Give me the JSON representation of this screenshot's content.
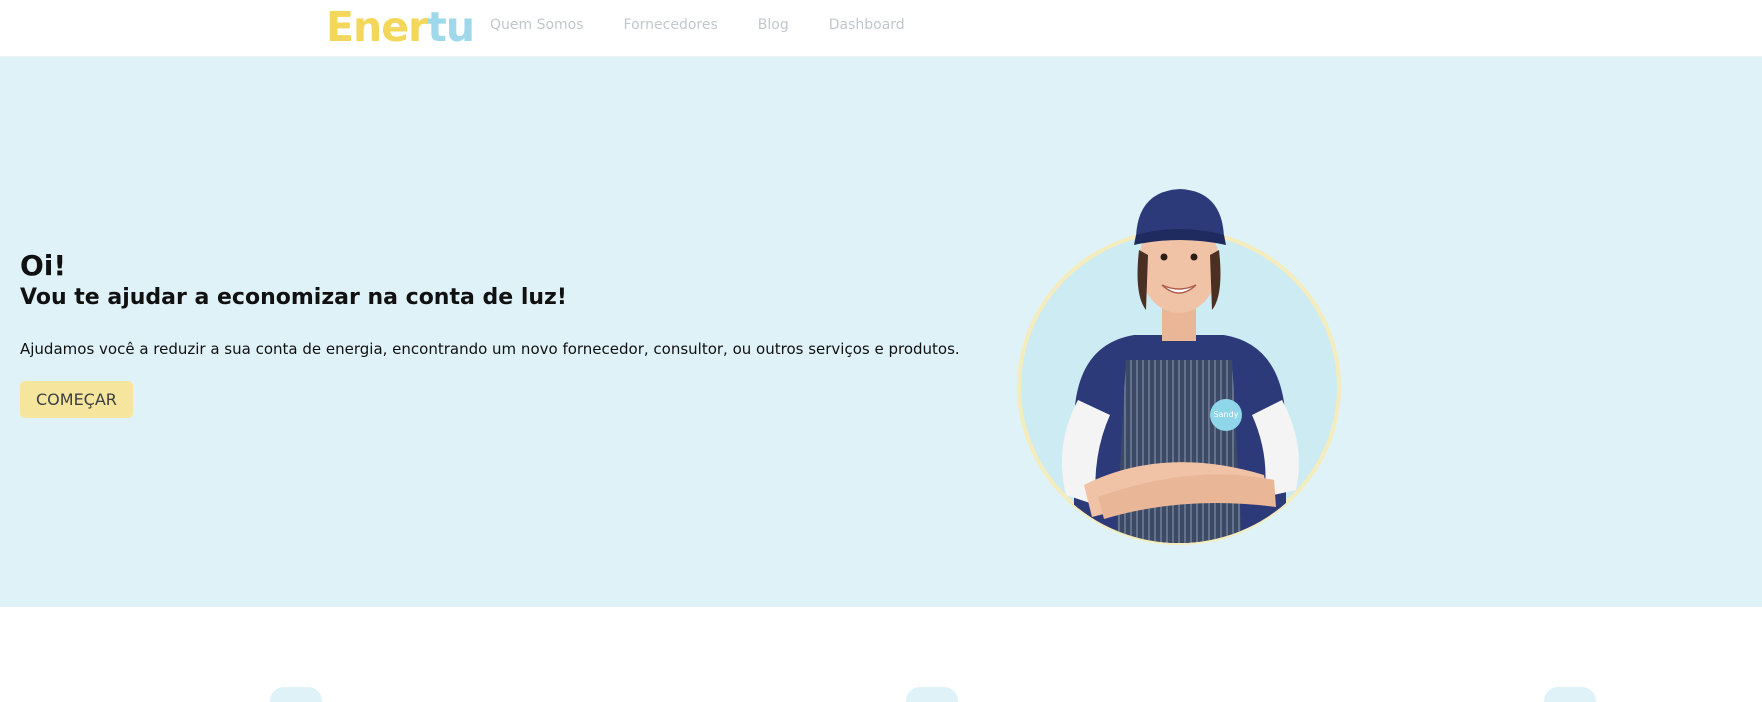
{
  "brand": {
    "logo_part1": "Ener",
    "logo_part2": "tu",
    "color_primary": "#f3d75a",
    "color_secondary": "#9fd8ea"
  },
  "nav": {
    "items": [
      {
        "label": "Quem Somos"
      },
      {
        "label": "Fornecedores"
      },
      {
        "label": "Blog"
      },
      {
        "label": "Dashboard"
      }
    ]
  },
  "hero": {
    "greeting": "Oi!",
    "title": "Vou te ajudar a economizar na conta de luz!",
    "description": "Ajudamos você a reduzir a sua conta de energia, encontrando um novo fornecedor, consultor, ou outros serviços e produtos.",
    "cta_label": "COMEÇAR",
    "background": "#dff2f8",
    "badge_text": "Sandy"
  },
  "features": {
    "icons": [
      "feature-icon",
      "feature-icon",
      "feature-icon"
    ]
  }
}
